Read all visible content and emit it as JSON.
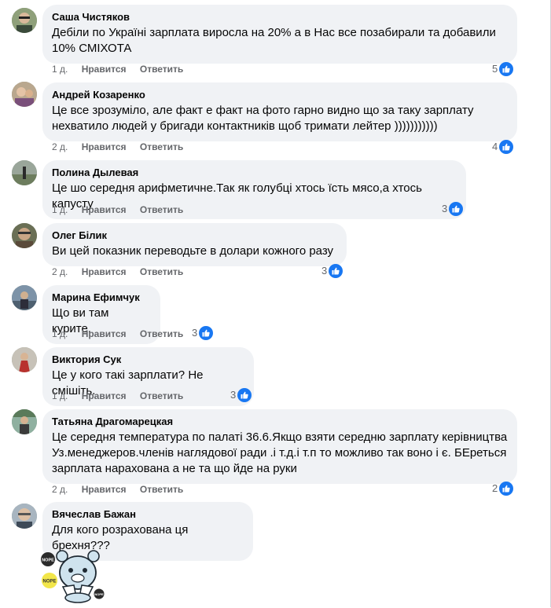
{
  "colors": {
    "bubble": "#f0f2f5",
    "like": "#1877f2",
    "meta": "#65676b"
  },
  "actions": {
    "like_label": "Нравится",
    "reply_label": "Ответить"
  },
  "comments": [
    {
      "author": "Саша Чистяков",
      "lines": [
        "Дебіли по Україні зарплата виросла на 20% а в Нас все позабирали та добавили",
        "10% СМІХОТА"
      ],
      "time": "1 д.",
      "likes": "5"
    },
    {
      "author": "Андрей Козаренко",
      "lines": [
        "Це все зрозуміло, але факт е факт на фото гарно видно що за таку зарплату",
        "нехватило людей у бригади контактників щоб тримати лейтер )))))))))))"
      ],
      "time": "2 д.",
      "likes": "4"
    },
    {
      "author": "Полина Дылевая",
      "lines": [
        "Це шо середня арифметичне.Так як голубці хтось їсть мясо,а хтось капусту"
      ],
      "time": "1 д.",
      "likes": "3"
    },
    {
      "author": "Олег Білик",
      "lines": [
        "Ви цей показник переводьте в долари кожного разу"
      ],
      "time": "2 д.",
      "likes": "3"
    },
    {
      "author": "Марина Ефимчук",
      "lines": [
        "Що ви там курите."
      ],
      "time": "1 д.",
      "likes": "3"
    },
    {
      "author": "Виктория Сук",
      "lines": [
        "Це у кого такі зарплати? Не смішіть."
      ],
      "time": "1 д.",
      "likes": "3"
    },
    {
      "author": "Татьяна Драгомарецкая",
      "lines": [
        "Це середня температура по палаті 36.6.Якщо взяти середню зарплату керівництва",
        "Уз.менеджеров.членів наглядової ради .і т.д.і т.п то можливо так воно і є. БЕреться",
        "зарплата нарахована а не та що йде на руки"
      ],
      "time": "2 д.",
      "likes": "2"
    },
    {
      "author": "Вячеслав Бажан",
      "lines": [
        "Для кого розрахована ця брехня???"
      ],
      "time": "",
      "likes": ""
    }
  ],
  "sticker": {
    "label_1": "NOPE",
    "label_2": "NOPE",
    "label_3": "NOPE",
    "icon": "nope-bear-sticker"
  }
}
